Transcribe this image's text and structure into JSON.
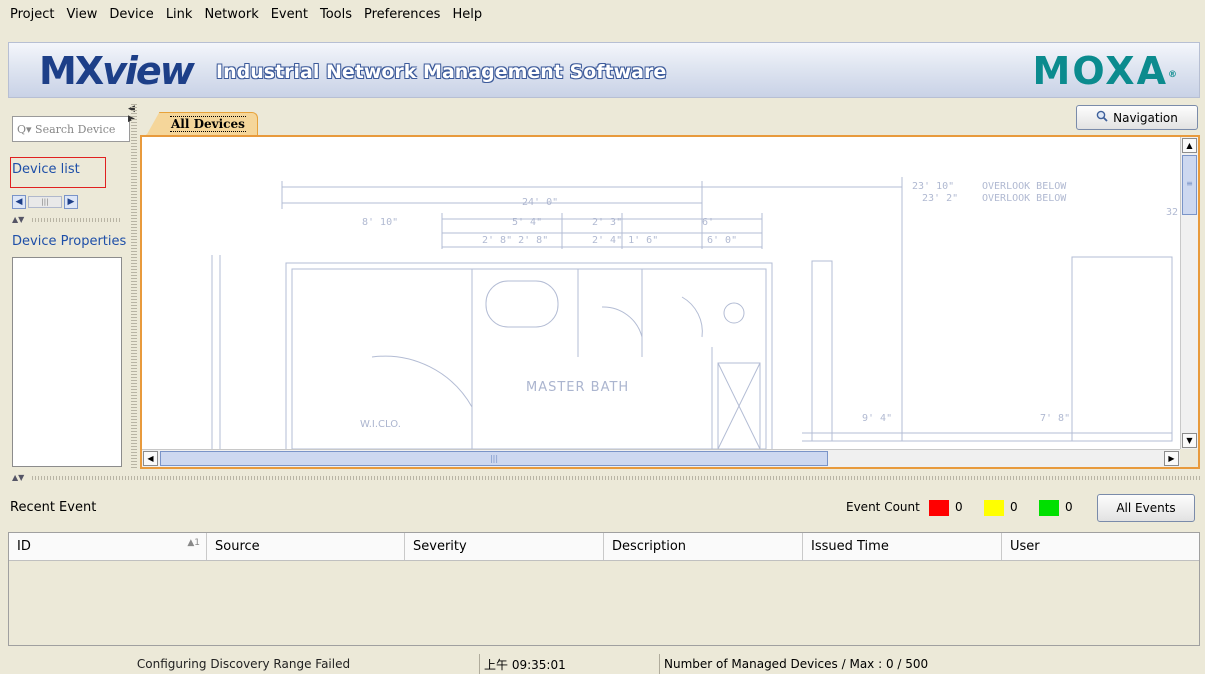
{
  "menu": [
    "Project",
    "View",
    "Device",
    "Link",
    "Network",
    "Event",
    "Tools",
    "Preferences",
    "Help"
  ],
  "banner": {
    "logo_mx": "MX",
    "logo_view": "view",
    "subtitle": "Industrial Network Management Software",
    "brand": "MOXA",
    "brand_mark": "®"
  },
  "left_panel": {
    "search_placeholder": "Q▾ Search Device",
    "device_list_label": "Device list",
    "device_properties_label": "Device Properties"
  },
  "tabs": {
    "active": "All Devices"
  },
  "navigation_button": "Navigation",
  "floorplan_labels": [
    "MASTER BATH",
    "W.I.CLO."
  ],
  "events": {
    "title": "Recent Event",
    "count_label": "Event Count",
    "counts": [
      {
        "color": "#ff0000",
        "value": "0"
      },
      {
        "color": "#ffff00",
        "value": "0"
      },
      {
        "color": "#00e000",
        "value": "0"
      }
    ],
    "all_events_button": "All Events",
    "columns": [
      "ID",
      "Source",
      "Severity",
      "Description",
      "Issued Time",
      "User"
    ],
    "sort_indicator": "▲1"
  },
  "status": {
    "message": "Configuring Discovery Range Failed",
    "time": "上午 09:35:01",
    "managed": "Number of Managed Devices / Max : 0 / 500"
  }
}
